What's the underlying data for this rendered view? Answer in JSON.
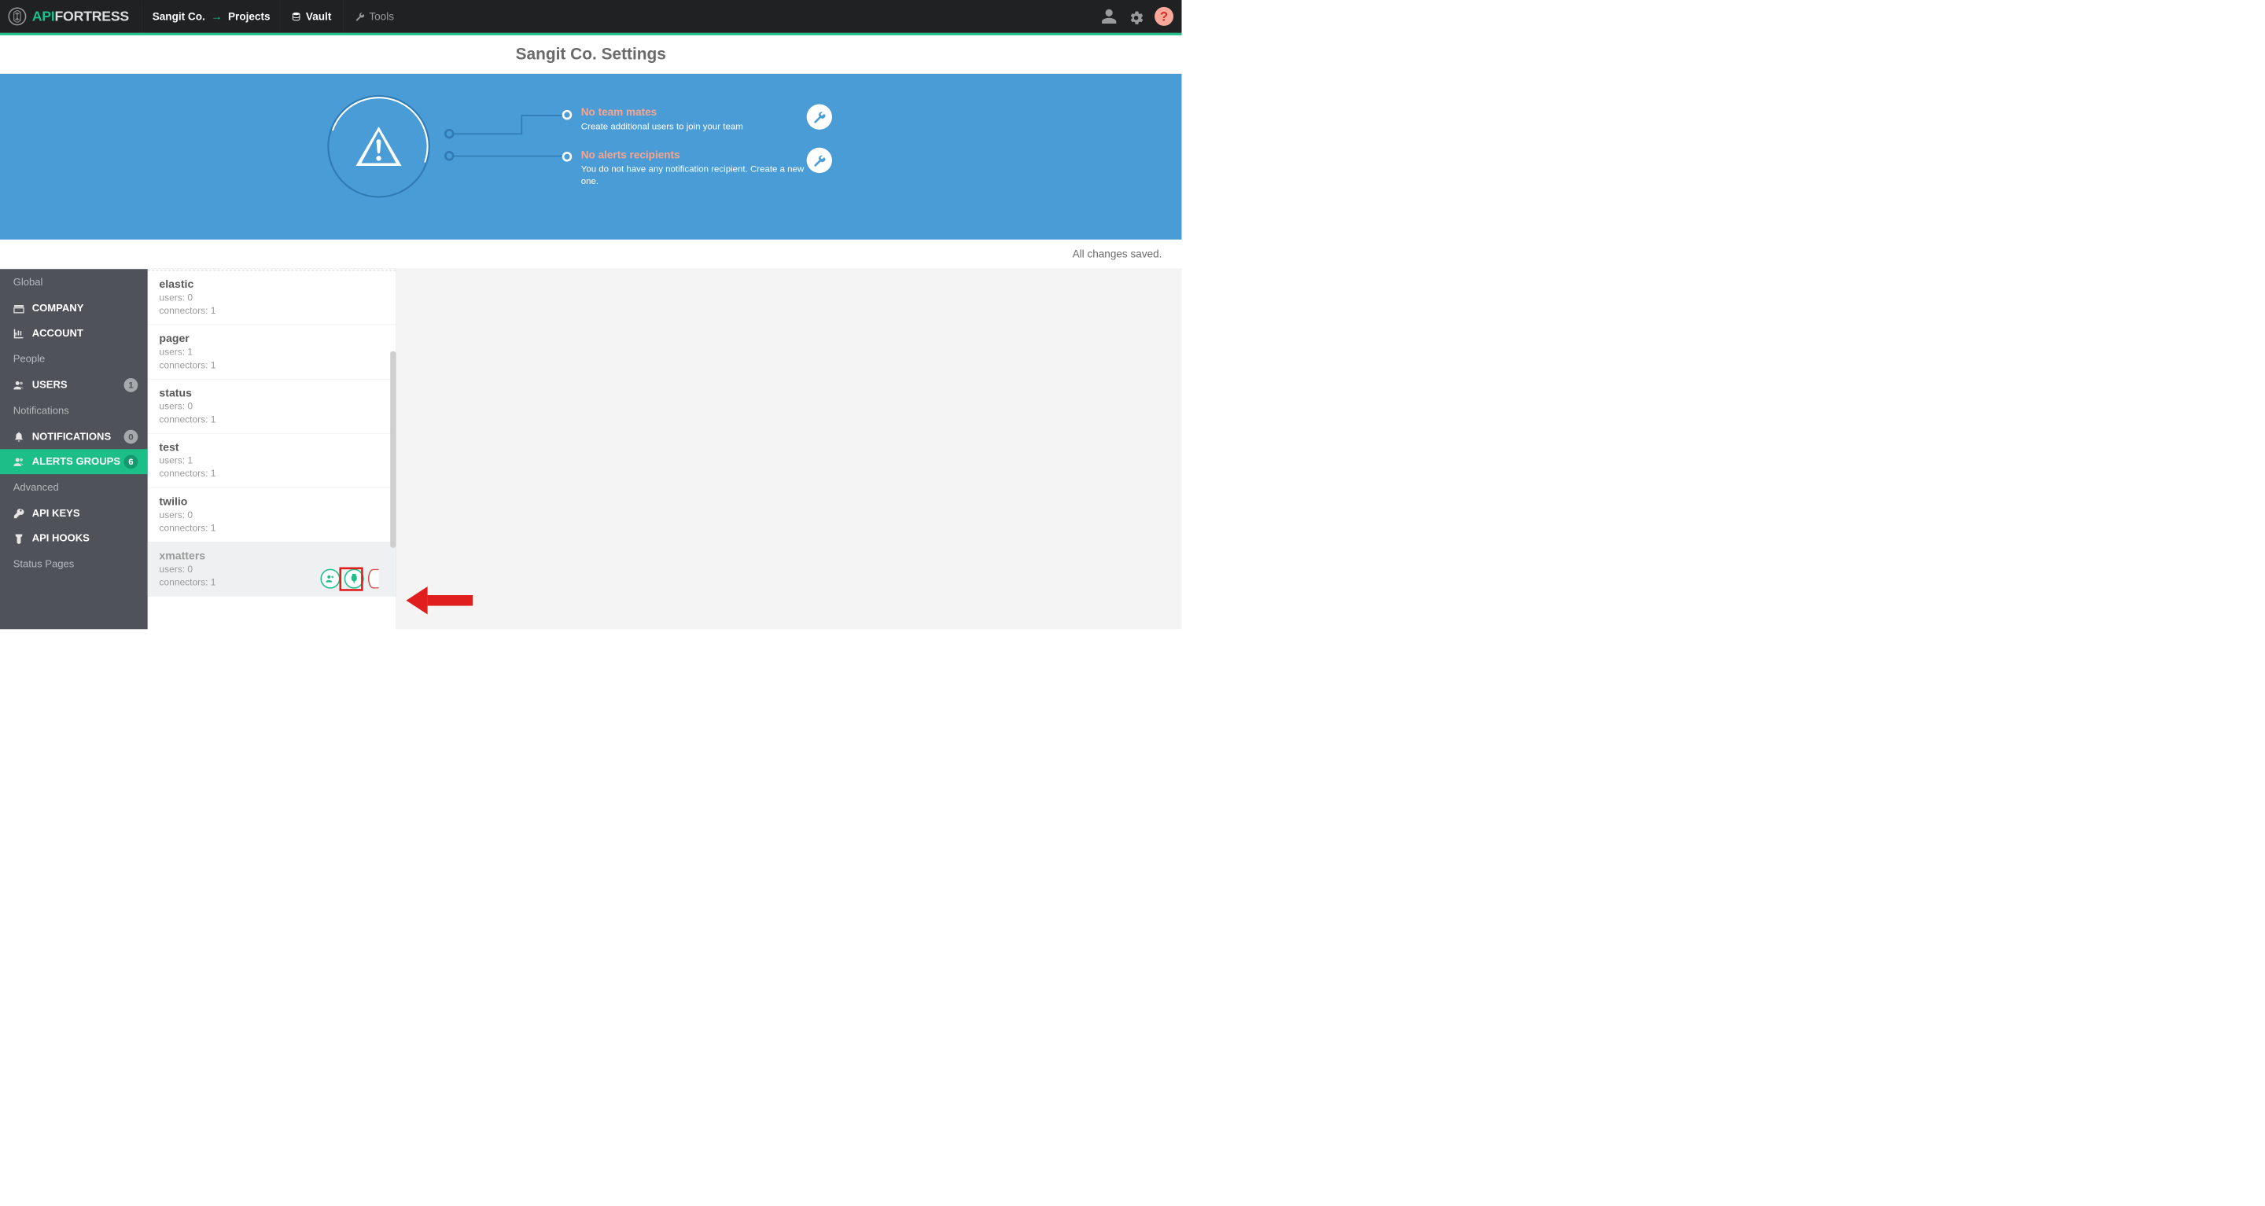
{
  "brand": {
    "api": "API",
    "fortress": "FORTRESS"
  },
  "nav": {
    "company": "Sangit Co.",
    "projects": "Projects",
    "vault": "Vault",
    "tools": "Tools"
  },
  "page_title": "Sangit Co. Settings",
  "banner": {
    "a1_title": "No team mates",
    "a1_sub": "Create additional users to join your team",
    "a2_title": "No alerts recipients",
    "a2_sub": "You do not have any notification recipient. Create a new one."
  },
  "status_bar": "All changes saved.",
  "sidebar": {
    "sections": {
      "global": "Global",
      "people": "People",
      "notifications": "Notifications",
      "advanced": "Advanced",
      "status_pages": "Status Pages"
    },
    "items": {
      "company": "COMPANY",
      "account": "ACCOUNT",
      "users": "USERS",
      "users_count": "1",
      "notifications": "NOTIFICATIONS",
      "notifications_count": "0",
      "alerts_groups": "ALERTS GROUPS",
      "alerts_groups_count": "6",
      "api_keys": "API KEYS",
      "api_hooks": "API HOOKS"
    }
  },
  "alert_groups": [
    {
      "name": "elastic",
      "users": "users: 0",
      "connectors": "connectors: 1"
    },
    {
      "name": "pager",
      "users": "users: 1",
      "connectors": "connectors: 1"
    },
    {
      "name": "status",
      "users": "users: 0",
      "connectors": "connectors: 1"
    },
    {
      "name": "test",
      "users": "users: 1",
      "connectors": "connectors: 1"
    },
    {
      "name": "twilio",
      "users": "users: 0",
      "connectors": "connectors: 1"
    },
    {
      "name": "xmatters",
      "users": "users: 0",
      "connectors": "connectors: 1"
    }
  ]
}
